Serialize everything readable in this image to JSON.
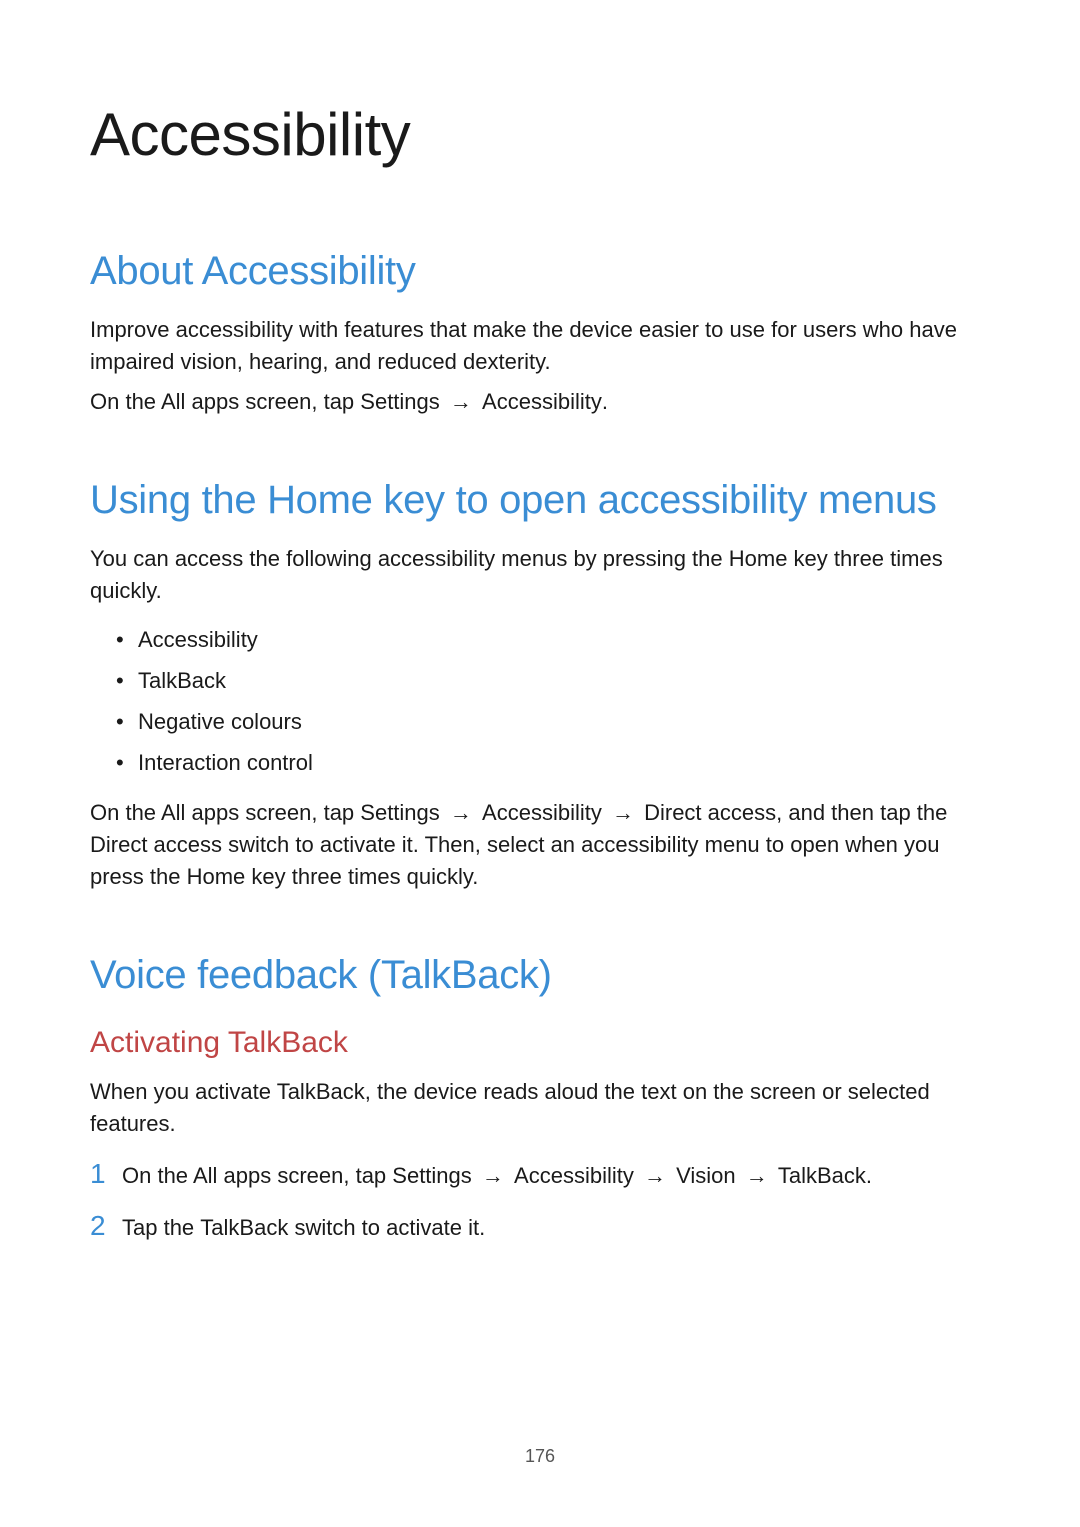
{
  "page": {
    "title": "Accessibility",
    "number": "176"
  },
  "sections": {
    "about": {
      "heading": "About Accessibility",
      "p1": "Improve accessibility with features that make the device easier to use for users who have impaired vision, hearing, and reduced dexterity.",
      "nav_prefix": "On the All apps screen, tap ",
      "nav_settings": "Settings",
      "nav_arrow": "→",
      "nav_accessibility": "Accessibility",
      "nav_suffix": "."
    },
    "homekey": {
      "heading": "Using the Home key to open accessibility menus",
      "p1": "You can access the following accessibility menus by pressing the Home key three times quickly.",
      "bullets": {
        "b1": "Accessibility",
        "b2": "TalkBack",
        "b3": "Negative colours",
        "b4": "Interaction control"
      },
      "p2_1": "On the All apps screen, tap ",
      "p2_settings": "Settings",
      "p2_arrow1": "→",
      "p2_accessibility": "Accessibility",
      "p2_arrow2": "→",
      "p2_direct": "Direct access",
      "p2_2": ", and then tap the ",
      "p2_direct2": "Direct access",
      "p2_3": " switch to activate it. Then, select an accessibility menu to open when you press the Home key three times quickly."
    },
    "voice": {
      "heading": "Voice feedback (TalkBack)",
      "sub_heading": "Activating TalkBack",
      "p1": "When you activate TalkBack, the device reads aloud the text on the screen or selected features.",
      "steps": {
        "s1_num": "1",
        "s1_prefix": "On the All apps screen, tap ",
        "s1_settings": "Settings",
        "s1_arrow1": "→",
        "s1_accessibility": "Accessibility",
        "s1_arrow2": "→",
        "s1_vision": "Vision",
        "s1_arrow3": "→",
        "s1_talkback": "TalkBack",
        "s1_suffix": ".",
        "s2_num": "2",
        "s2_prefix": "Tap the ",
        "s2_talkback": "TalkBack",
        "s2_suffix": " switch to activate it."
      }
    }
  }
}
